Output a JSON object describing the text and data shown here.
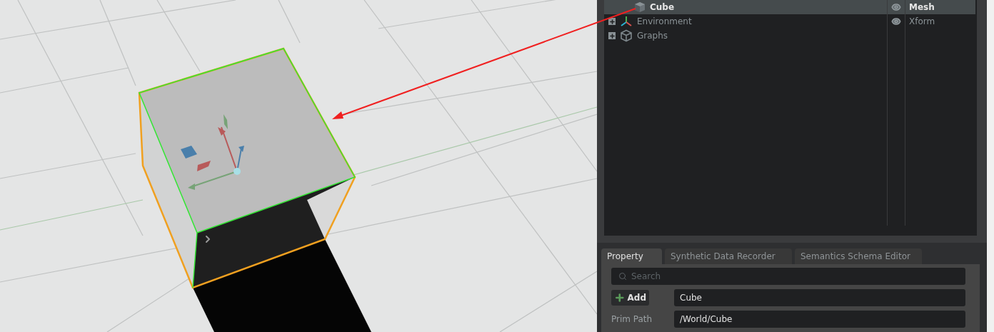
{
  "stage": {
    "rows": [
      {
        "name": "Cube",
        "type": "Mesh",
        "kind": "mesh",
        "selected": true,
        "visible": true,
        "expandable": false
      },
      {
        "name": "Environment",
        "type": "Xform",
        "kind": "xform",
        "selected": false,
        "visible": true,
        "expandable": true
      },
      {
        "name": "Graphs",
        "kind": "scope",
        "selected": false,
        "visible": false,
        "expandable": true
      }
    ]
  },
  "property": {
    "tabs": [
      {
        "label": "Property",
        "selected": true
      },
      {
        "label": "Synthetic Data Recorder",
        "selected": false
      },
      {
        "label": "Semantics Schema Editor",
        "selected": false
      }
    ],
    "search": {
      "placeholder": "Search"
    },
    "add_button": "Add",
    "name_value": "Cube",
    "fields": [
      {
        "label": "Prim Path",
        "value": "/World/Cube"
      }
    ]
  }
}
